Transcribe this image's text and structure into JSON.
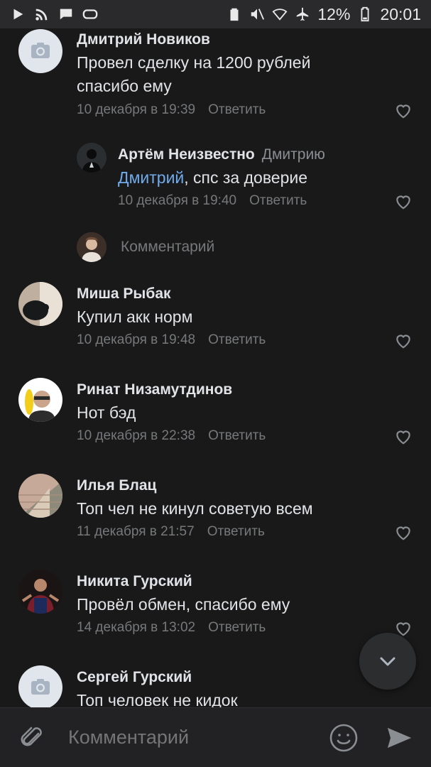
{
  "status_bar": {
    "battery": "12%",
    "time": "20:01",
    "left_icons": [
      "play-icon",
      "rss-icon",
      "chat-icon",
      "vr-icon"
    ],
    "right_icons": [
      "battery-saver-icon",
      "mute-icon",
      "wifi-icon",
      "airplane-icon",
      "battery-icon"
    ]
  },
  "comments": [
    {
      "author": "Дмитрий Новиков",
      "text_lines": [
        "Провел сделку на 1200 рублей",
        "спасибо ему"
      ],
      "date": "10 декабря в 19:39",
      "reply_label": "Ответить",
      "avatar": "camera-placeholder"
    },
    {
      "author": "Артём Неизвестно",
      "reply_to": "Дмитрию",
      "mention": "Дмитрий",
      "text": ", спс за доверие",
      "date": "10 декабря в 19:40",
      "reply_label": "Ответить",
      "avatar": "dark-photo"
    },
    {
      "author": "Миша Рыбак",
      "text": "Купил акк норм",
      "date": "10 декабря в 19:48",
      "reply_label": "Ответить",
      "avatar": "photo"
    },
    {
      "author": "Ринат Низамутдинов",
      "text": "Нот бэд",
      "date": "10 декабря в 22:38",
      "reply_label": "Ответить",
      "avatar": "photo"
    },
    {
      "author": "Илья Блац",
      "text": "Топ чел не кинул советую всем",
      "date": "11 декабря в 21:57",
      "reply_label": "Ответить",
      "avatar": "photo"
    },
    {
      "author": "Никита Гурский",
      "text": "Провёл обмен, спасибо ему",
      "date": "14 декабря в 13:02",
      "reply_label": "Ответить",
      "avatar": "photo"
    },
    {
      "author": "Сергей Гурский",
      "text": "Топ человек не кидок",
      "avatar": "camera-placeholder"
    }
  ],
  "add_reply": {
    "placeholder": "Комментарий"
  },
  "composer": {
    "placeholder": "Комментарий"
  },
  "colors": {
    "background": "#19191a",
    "text_primary": "#e1e3e6",
    "text_secondary": "#76787a",
    "mention": "#71aaeb"
  }
}
